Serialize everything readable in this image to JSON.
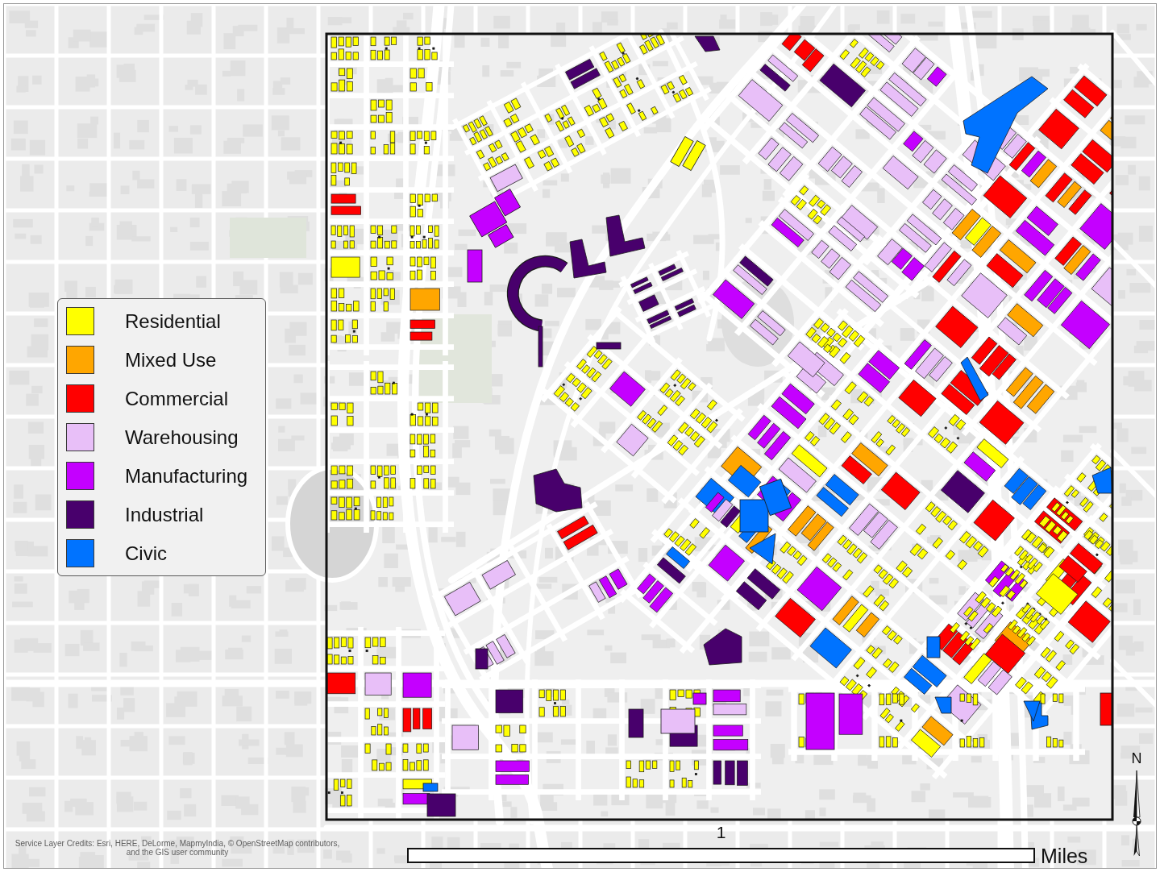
{
  "legend": {
    "items": [
      {
        "label": "Residential",
        "color": "#ffff00"
      },
      {
        "label": "Mixed Use",
        "color": "#ffa600"
      },
      {
        "label": "Commercial",
        "color": "#ff0000"
      },
      {
        "label": "Warehousing",
        "color": "#e8bff8"
      },
      {
        "label": "Manufacturing",
        "color": "#c400ff"
      },
      {
        "label": "Industrial",
        "color": "#48006c"
      },
      {
        "label": "Civic",
        "color": "#0073ff"
      }
    ]
  },
  "scale_bar": {
    "label": "1",
    "unit": "Miles"
  },
  "north_arrow": {
    "label": "N"
  },
  "credits": "Service Layer Credits: Esri, HERE, DeLorme, MapmyIndia, © OpenStreetMap contributors, and the GIS user community"
}
